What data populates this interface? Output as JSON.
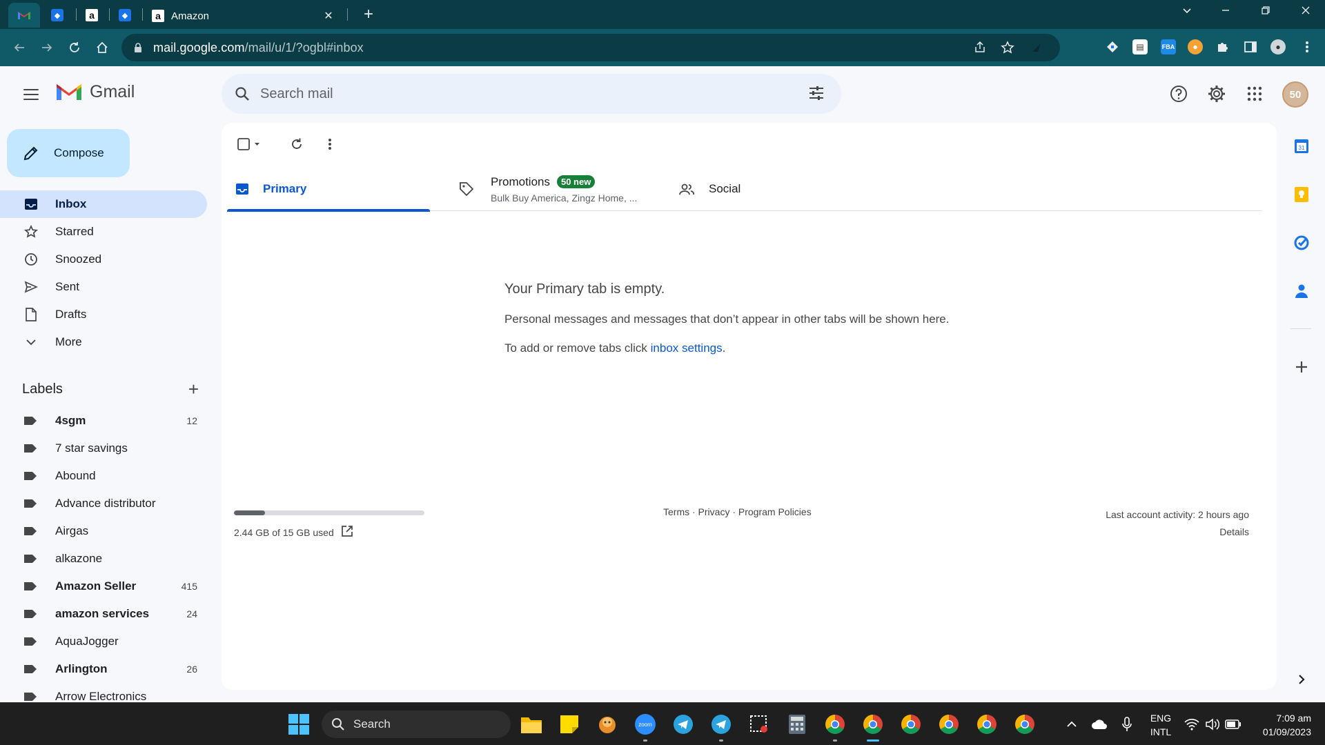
{
  "browser": {
    "active_tab_title": "Amazon",
    "url_host": "mail.google.com",
    "url_path": "/mail/u/1/?ogbl#inbox",
    "new_tab_symbol": "+",
    "close_symbol": "✕"
  },
  "gmail": {
    "logo_text": "Gmail",
    "search_placeholder": "Search mail",
    "compose_label": "Compose",
    "avatar_text": "50"
  },
  "nav": {
    "items": [
      {
        "label": "Inbox",
        "icon": "inbox-icon",
        "active": true
      },
      {
        "label": "Starred",
        "icon": "star-icon"
      },
      {
        "label": "Snoozed",
        "icon": "clock-icon"
      },
      {
        "label": "Sent",
        "icon": "send-icon"
      },
      {
        "label": "Drafts",
        "icon": "draft-icon"
      },
      {
        "label": "More",
        "icon": "chevron-down-icon"
      }
    ]
  },
  "labels": {
    "title": "Labels",
    "add_symbol": "+",
    "items": [
      {
        "name": "4sgm",
        "count": "12",
        "bold": true
      },
      {
        "name": "7 star savings",
        "count": "",
        "bold": false
      },
      {
        "name": "Abound",
        "count": "",
        "bold": false
      },
      {
        "name": "Advance distributor",
        "count": "",
        "bold": false
      },
      {
        "name": "Airgas",
        "count": "",
        "bold": false
      },
      {
        "name": "alkazone",
        "count": "",
        "bold": false
      },
      {
        "name": "Amazon Seller",
        "count": "415",
        "bold": true
      },
      {
        "name": "amazon services",
        "count": "24",
        "bold": true
      },
      {
        "name": "AquaJogger",
        "count": "",
        "bold": false
      },
      {
        "name": "Arlington",
        "count": "26",
        "bold": true
      },
      {
        "name": "Arrow Electronics",
        "count": "",
        "bold": false
      }
    ]
  },
  "inbox_tabs": {
    "primary": "Primary",
    "promotions": "Promotions",
    "promotions_badge": "50 new",
    "promotions_senders": "Bulk Buy America, Zingz Home, ...",
    "social": "Social"
  },
  "empty_state": {
    "title": "Your Primary tab is empty.",
    "description": "Personal messages and messages that don’t appear in other tabs will be shown here.",
    "settings_prefix": "To add or remove tabs click ",
    "settings_link": "inbox settings",
    "settings_suffix": "."
  },
  "footer": {
    "storage_used": "2.44 GB of 15 GB used",
    "storage_fraction": 0.163,
    "links": "Terms · Privacy · Program Policies",
    "last_activity": "Last account activity: 2 hours ago",
    "details": "Details"
  },
  "taskbar": {
    "search_label": "Search",
    "lang_top": "ENG",
    "lang_bottom": "INTL",
    "time": "7:09 am",
    "date": "01/09/2023",
    "zoom_label": "zoom"
  },
  "colors": {
    "accent": "#0b57d0",
    "badge_green": "#188038",
    "browser_frame": "#0b3c45",
    "browser_toolbar": "#0f5a66",
    "nav_active": "#d3e3fd",
    "compose_bg": "#c2e7ff"
  }
}
